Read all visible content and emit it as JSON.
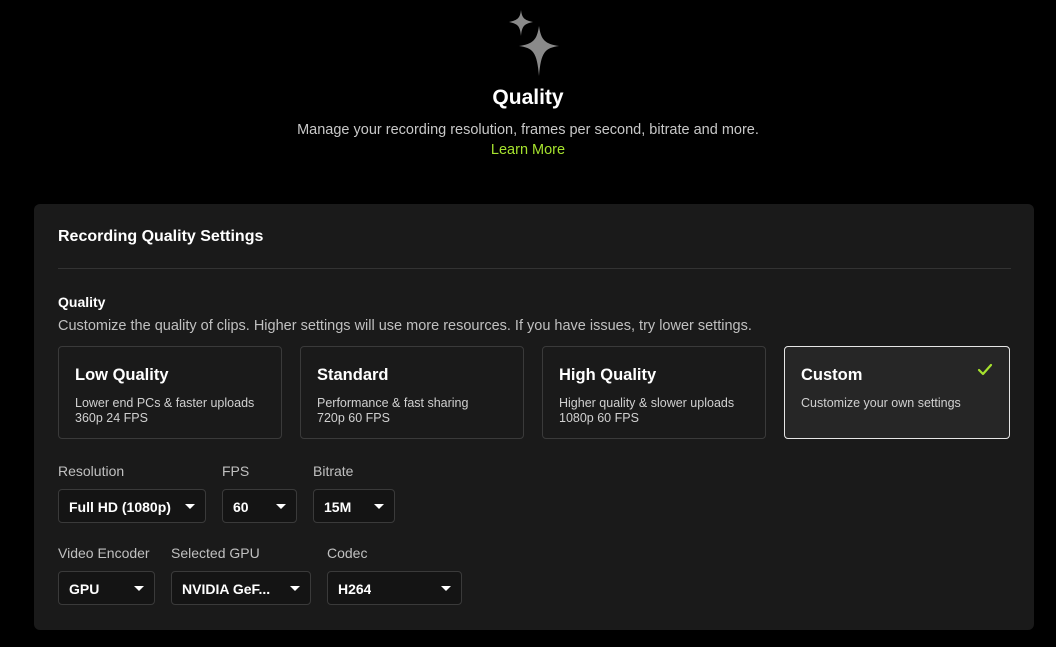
{
  "header": {
    "icon": "sparkle-icon",
    "title": "Quality",
    "subtitle": "Manage your recording resolution, frames per second, bitrate and more.",
    "learn_more": "Learn More"
  },
  "panel": {
    "title": "Recording Quality Settings",
    "quality": {
      "label": "Quality",
      "description": "Customize the quality of clips. Higher settings will use more resources. If you have issues, try lower settings.",
      "presets": [
        {
          "title": "Low Quality",
          "line1": "Lower end PCs & faster uploads",
          "line2": "360p 24 FPS",
          "selected": false
        },
        {
          "title": "Standard",
          "line1": "Performance & fast sharing",
          "line2": "720p 60 FPS",
          "selected": false
        },
        {
          "title": "High Quality",
          "line1": "Higher quality & slower uploads",
          "line2": "1080p 60 FPS",
          "selected": false
        },
        {
          "title": "Custom",
          "line1": "Customize your own settings",
          "line2": "",
          "selected": true
        }
      ]
    },
    "fields": {
      "resolution": {
        "label": "Resolution",
        "value": "Full HD (1080p)"
      },
      "fps": {
        "label": "FPS",
        "value": "60"
      },
      "bitrate": {
        "label": "Bitrate",
        "value": "15M"
      },
      "video_encoder": {
        "label": "Video Encoder",
        "value": "GPU"
      },
      "selected_gpu": {
        "label": "Selected GPU",
        "value": "NVIDIA GeF..."
      },
      "codec": {
        "label": "Codec",
        "value": "H264"
      }
    }
  },
  "colors": {
    "accent": "#a6e22e",
    "background": "#000000",
    "panel": "#1a1a1a",
    "selected_border": "#e6e6e6"
  }
}
